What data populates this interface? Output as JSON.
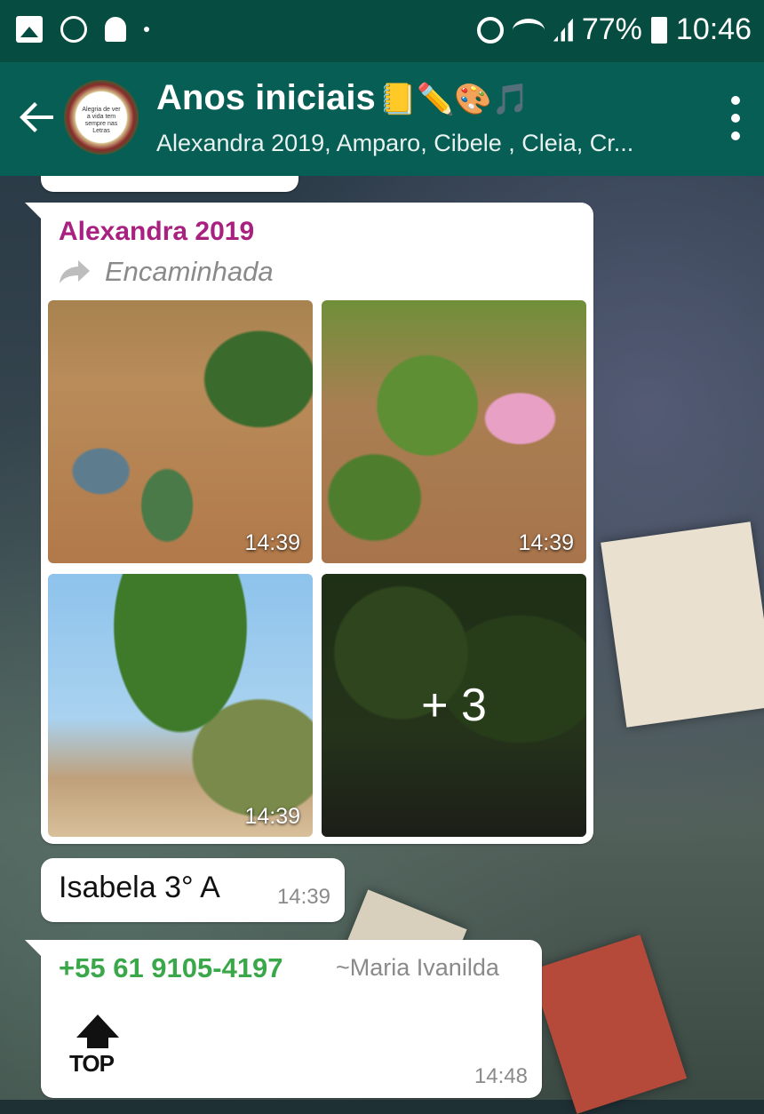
{
  "status_bar": {
    "battery": "77%",
    "time": "10:46",
    "icons": [
      "gallery-icon",
      "whatsapp-icon",
      "bell-icon",
      "dot-icon",
      "alarm-icon",
      "wifi-icon",
      "signal-icon",
      "battery-icon"
    ]
  },
  "header": {
    "title": "Anos iniciais",
    "title_emoji": "📒✏️🎨🎵",
    "subtitle": "Alexandra 2019, Amparo, Cibele , Cleia, Cr...",
    "avatar_text": "Alegria de ver a vida tem sempre nas Letras"
  },
  "album": {
    "sender": "Alexandra 2019",
    "sender_color": "#a8217e",
    "forwarded_label": "Encaminhada",
    "photos": [
      {
        "time": "14:39"
      },
      {
        "time": "14:39"
      },
      {
        "time": "14:39"
      },
      {
        "more": "+ 3"
      }
    ]
  },
  "messages": [
    {
      "text": "Isabela 3° A",
      "time": "14:39"
    },
    {
      "phone": "+55 61 9105-4197",
      "pushname": "~Maria  Ivanilda",
      "sticker_label": "TOP",
      "time": "14:48",
      "phone_color": "#3aa84a"
    }
  ]
}
